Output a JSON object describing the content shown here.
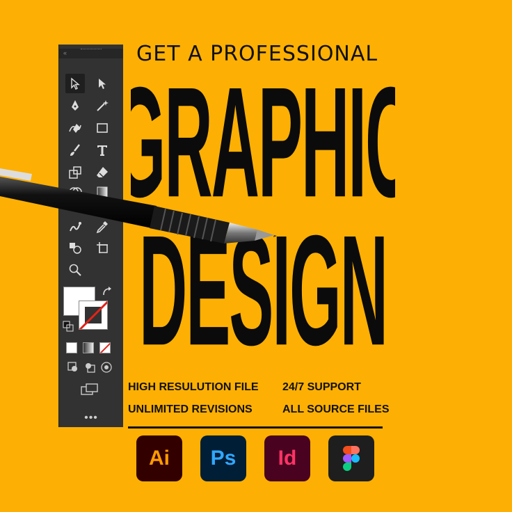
{
  "headline": {
    "tagline": "GET A PROFESSIONAL",
    "line1": "GRAPHIC",
    "line2": "DESIGN"
  },
  "features": [
    "HIGH RESULUTION FILE",
    "24/7 SUPPORT",
    "UNLIMITED REVISIONS",
    "ALL SOURCE FILES"
  ],
  "apps": [
    {
      "label": "Ai",
      "icon": "illustrator-icon"
    },
    {
      "label": "Ps",
      "icon": "photoshop-icon"
    },
    {
      "label": "Id",
      "icon": "indesign-icon"
    },
    {
      "label": "",
      "icon": "figma-icon"
    }
  ],
  "toolbar": {
    "collapse_glyph": "«",
    "more_glyph": "•••"
  },
  "colors": {
    "background": "#FDB003",
    "text": "#111111",
    "toolbar": "#323232",
    "illustrator_bg": "#330000",
    "illustrator_fg": "#FF9A00",
    "photoshop_bg": "#001E36",
    "photoshop_fg": "#31A8FF",
    "indesign_bg": "#49021F",
    "indesign_fg": "#FF3366"
  }
}
